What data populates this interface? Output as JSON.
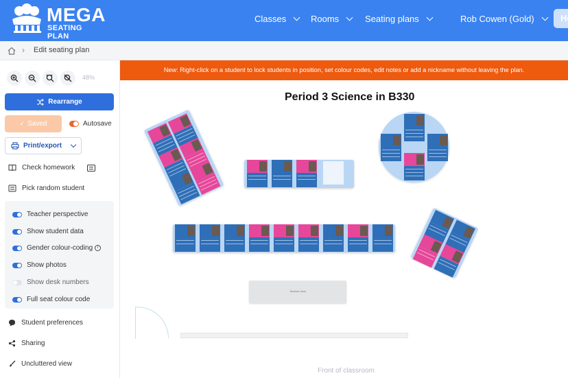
{
  "header": {
    "logo_title": "MEGA",
    "logo_subtitle": "SEATING PLAN",
    "nav": [
      {
        "label": "Classes"
      },
      {
        "label": "Rooms"
      },
      {
        "label": "Seating plans"
      }
    ],
    "user": "Rob Cowen (Gold)",
    "help_label": "He"
  },
  "breadcrumb": {
    "current": "Edit seating plan"
  },
  "banner": "New: Right-click on a student to lock students in position, set colour codes, edit notes or add a nickname without leaving the plan.",
  "toolbar": {
    "zoom_level": "48%",
    "rearrange_label": "Rearrange",
    "saved_label": "Saved",
    "autosave_label": "Autosave",
    "print_label": "Print/export"
  },
  "sidebar": {
    "items_top": [
      {
        "label": "Check homework"
      },
      {
        "label": "Pick random student"
      }
    ],
    "options": [
      {
        "label": "Teacher perspective",
        "on": true
      },
      {
        "label": "Show student data",
        "on": true
      },
      {
        "label": "Gender colour-coding",
        "on": true
      },
      {
        "label": "Show photos",
        "on": true
      },
      {
        "label": "Show desk numbers",
        "on": false
      },
      {
        "label": "Full seat colour code",
        "on": true
      }
    ],
    "items_bottom": [
      {
        "label": "Student preferences"
      },
      {
        "label": "Sharing"
      },
      {
        "label": "Uncluttered view"
      }
    ]
  },
  "plan": {
    "title": "Period 3 Science in B330",
    "teacher_desk": "Teacher desk",
    "front_label": "Front of classroom"
  },
  "colors": {
    "header_blue": "#3a82f0",
    "banner_orange": "#ee5a0e",
    "accent_blue": "#2f6fdd",
    "saved_peach": "#fbc9a7",
    "girl_pink": "#e6479a",
    "boy_blue": "#2f6fb8",
    "group_bg": "#b9d6f5"
  }
}
